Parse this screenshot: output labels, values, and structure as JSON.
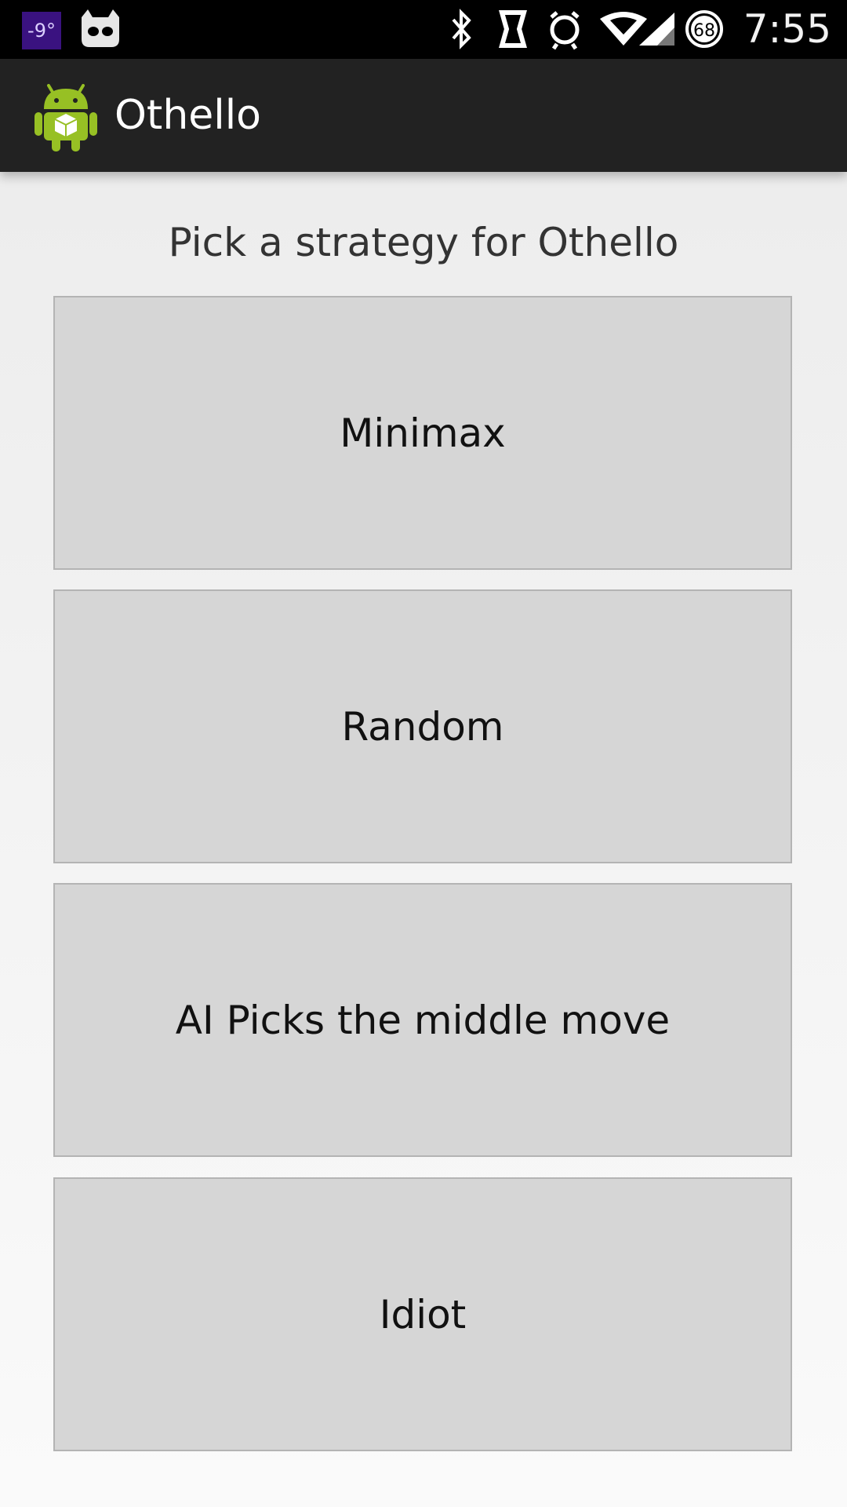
{
  "status_bar": {
    "temperature": "-9°",
    "battery_level": "68",
    "time": "7:55",
    "icons": [
      "cyanogen-cat-icon",
      "bluetooth-icon",
      "nfc-icon",
      "alarm-icon",
      "wifi-icon",
      "signal-icon",
      "battery-icon"
    ]
  },
  "action_bar": {
    "title": "Othello",
    "icon": "android-app-icon"
  },
  "main": {
    "prompt": "Pick a strategy for Othello",
    "strategies": [
      {
        "label": "Minimax"
      },
      {
        "label": "Random"
      },
      {
        "label": "AI Picks the middle move"
      },
      {
        "label": "Idiot"
      }
    ]
  },
  "colors": {
    "status_bar": "#000000",
    "action_bar": "#222222",
    "button": "#d6d6d6",
    "temp_badge": "#3a1280",
    "android_green": "#97c024"
  }
}
